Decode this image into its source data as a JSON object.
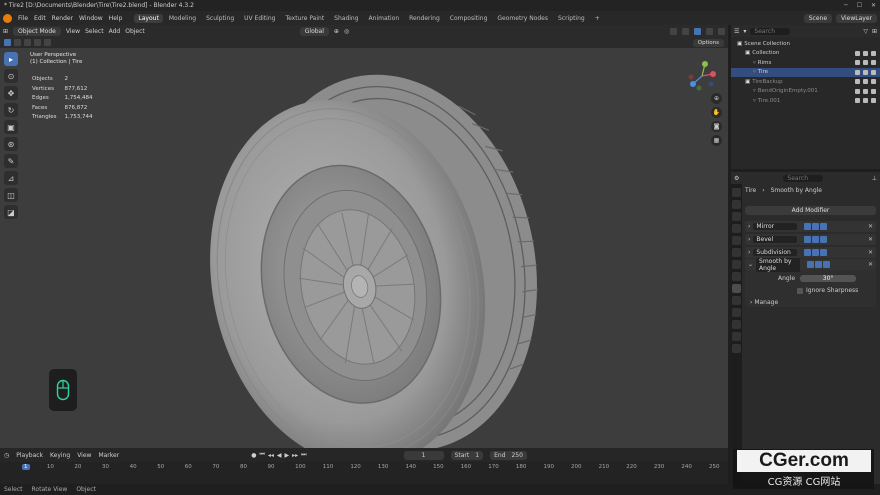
{
  "window": {
    "title": "* Tire2 [D:\\Documents\\Blender\\Tire\\Tire2.blend] - Blender 4.3.2"
  },
  "menu": [
    "File",
    "Edit",
    "Render",
    "Window",
    "Help"
  ],
  "workspaces": [
    "Layout",
    "Modeling",
    "Sculpting",
    "UV Editing",
    "Texture Paint",
    "Shading",
    "Animation",
    "Rendering",
    "Compositing",
    "Geometry Nodes",
    "Scripting"
  ],
  "topright": {
    "scene": "Scene",
    "view_layer": "ViewLayer"
  },
  "viewport_header": {
    "mode": "Object Mode",
    "view": "View",
    "select": "Select",
    "add": "Add",
    "object": "Object",
    "orientation": "Global",
    "options": "Options"
  },
  "overlay": {
    "view_name": "User Perspective",
    "collection": "(1) Collection | Tire"
  },
  "stats": [
    {
      "label": "Objects",
      "value": "2"
    },
    {
      "label": "Vertices",
      "value": "877,612"
    },
    {
      "label": "Edges",
      "value": "1,754,484"
    },
    {
      "label": "Faces",
      "value": "876,872"
    },
    {
      "label": "Triangles",
      "value": "1,753,744"
    }
  ],
  "outliner": {
    "search_placeholder": "Search",
    "items": [
      {
        "label": "Scene Collection",
        "indent": 0
      },
      {
        "label": "Collection",
        "indent": 1
      },
      {
        "label": "Rims",
        "indent": 2
      },
      {
        "label": "Tire",
        "indent": 2
      },
      {
        "label": "TireBackup",
        "indent": 1
      },
      {
        "label": "BendOriginEmpty.001",
        "indent": 2
      },
      {
        "label": "Tire.001",
        "indent": 2
      }
    ]
  },
  "properties": {
    "search_placeholder": "Search",
    "breadcrumb_object": "Tire",
    "breadcrumb_modifier": "Smooth by Angle",
    "add_modifier": "Add Modifier",
    "modifiers": [
      "Mirror",
      "Bevel",
      "Subdivision",
      "Smooth by Angle"
    ],
    "angle_label": "Angle",
    "angle_value": "30°",
    "ignore_sharpness": "Ignore Sharpness",
    "manage": "Manage"
  },
  "timeline": {
    "playback": "Playback",
    "keying": "Keying",
    "view": "View",
    "marker": "Marker",
    "current_frame": "1",
    "start_label": "Start",
    "start": "1",
    "end_label": "End",
    "end": "250",
    "ticks": [
      "1",
      "10",
      "20",
      "30",
      "40",
      "50",
      "60",
      "70",
      "80",
      "90",
      "100",
      "110",
      "120",
      "130",
      "140",
      "150",
      "160",
      "170",
      "180",
      "190",
      "200",
      "210",
      "220",
      "230",
      "240",
      "250"
    ]
  },
  "statusbar": {
    "select": "Select",
    "rotate": "Rotate View",
    "object": "Object"
  },
  "watermark": {
    "line1": "CGer.com",
    "line2": "CG资源 CG网站"
  }
}
